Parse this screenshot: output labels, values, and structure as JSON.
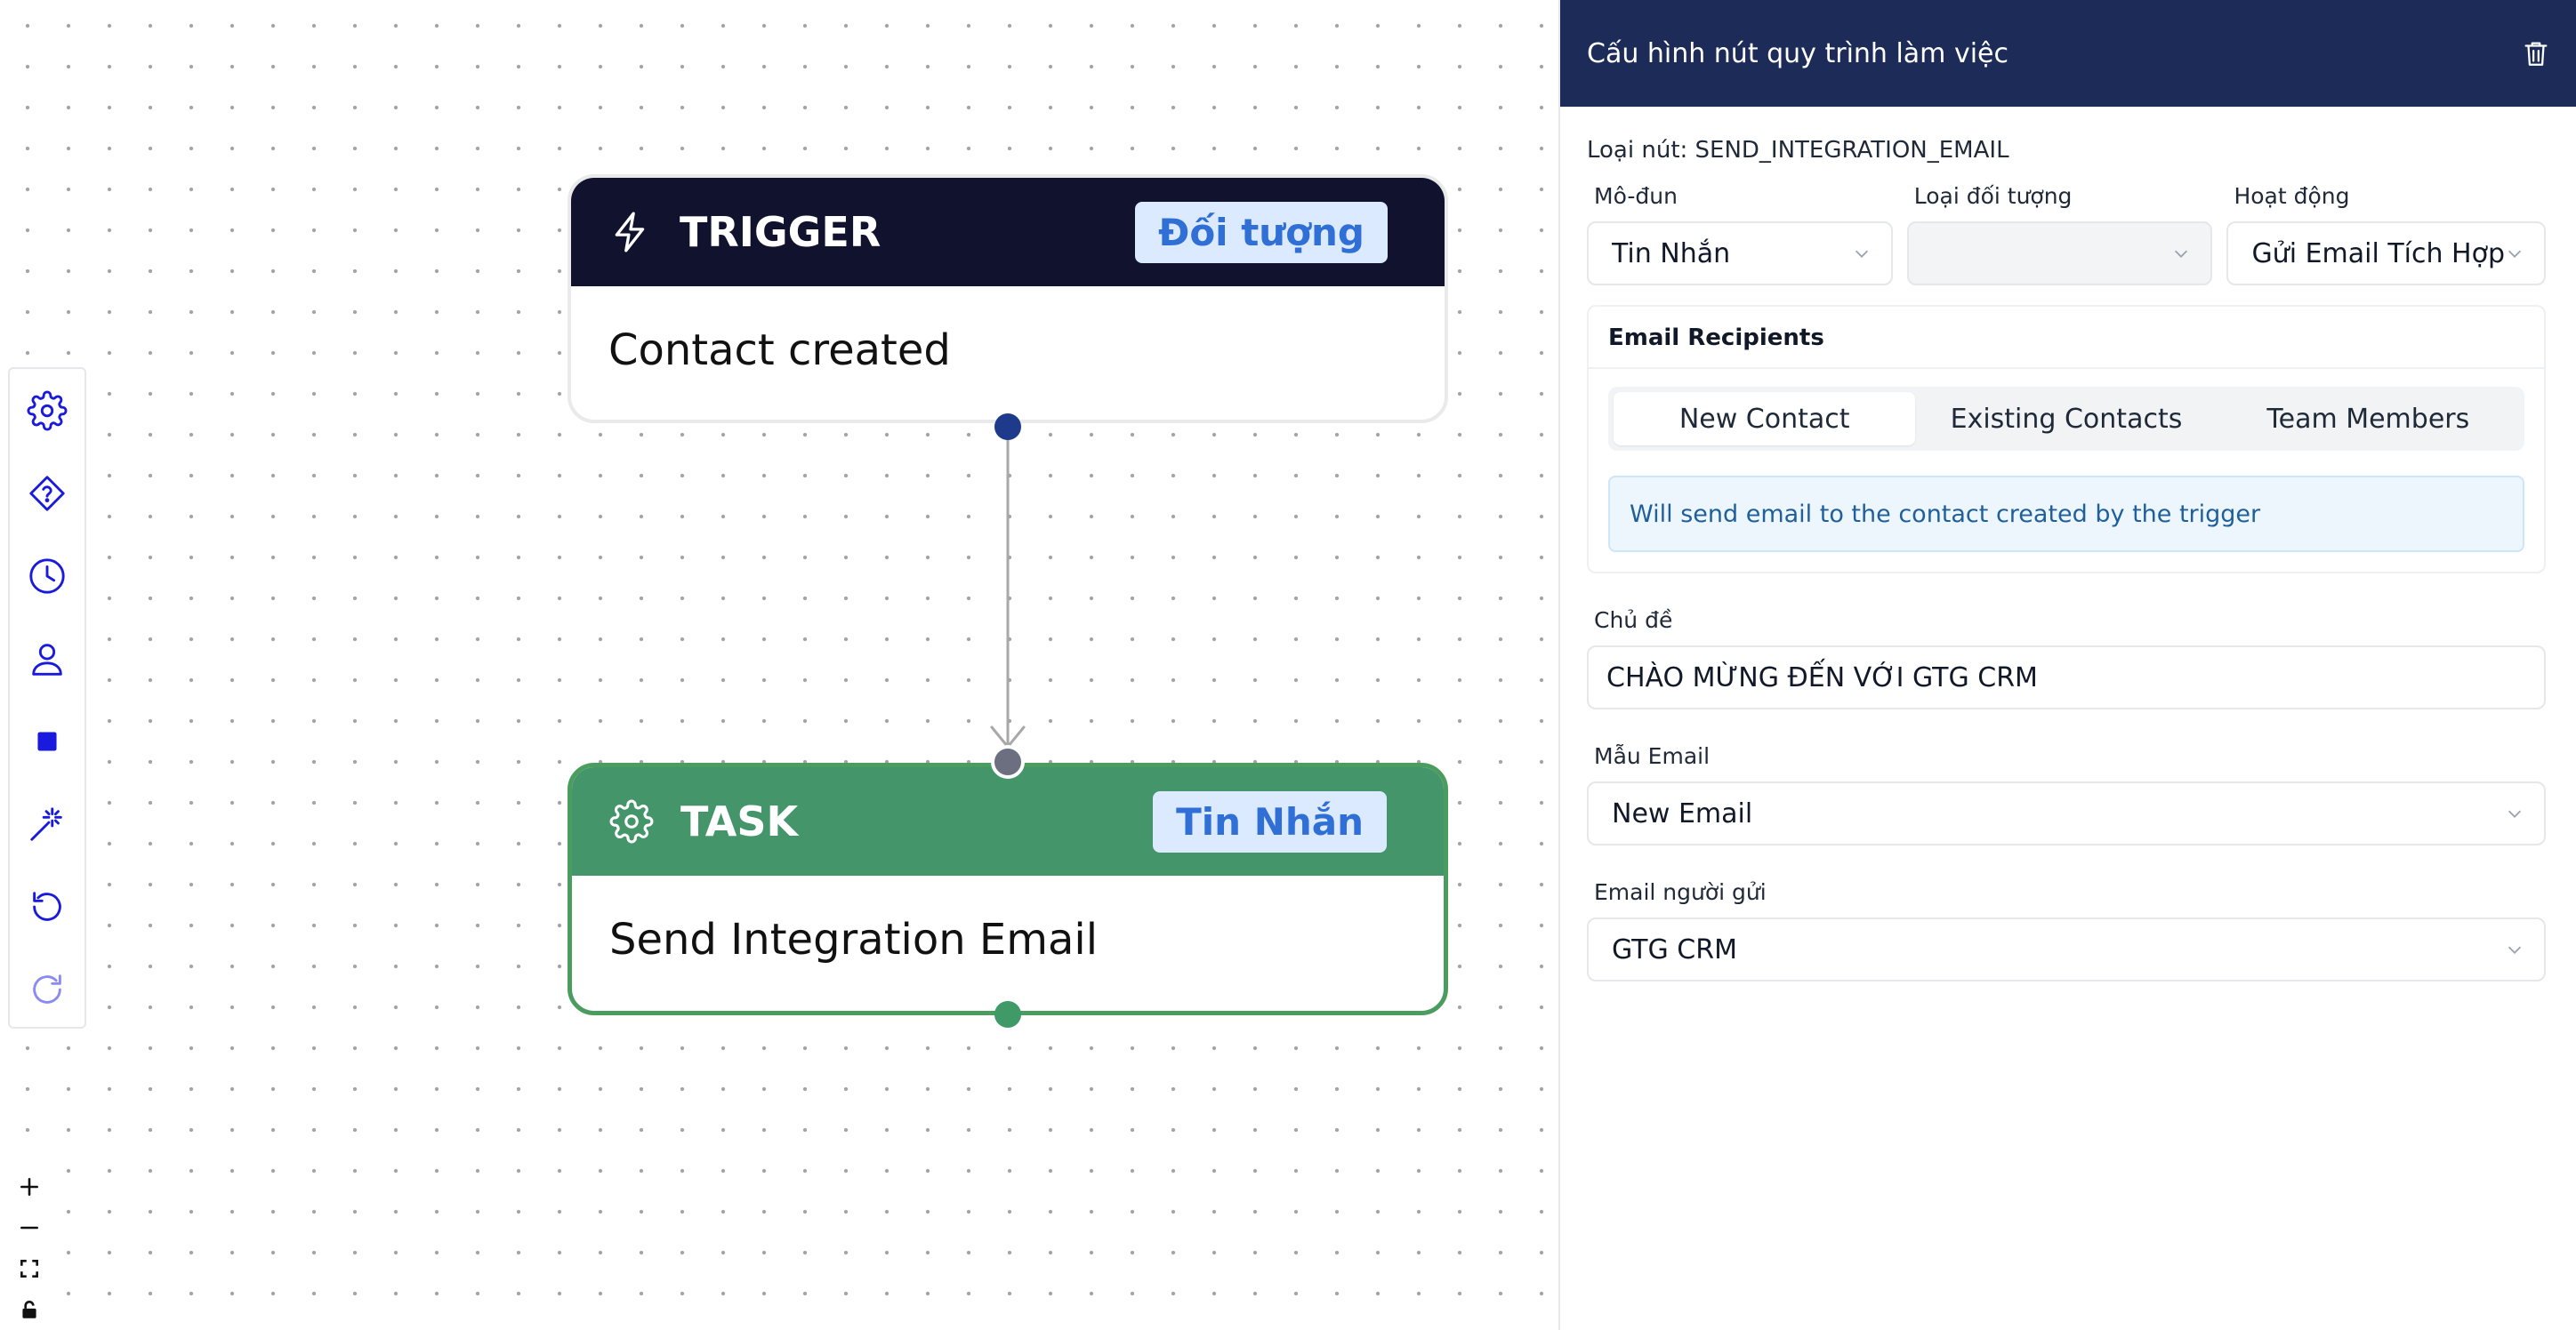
{
  "canvas": {
    "toolbar": [
      {
        "name": "settings-tool",
        "icon": "gear-icon"
      },
      {
        "name": "condition-tool",
        "icon": "diamond-question-icon"
      },
      {
        "name": "delay-tool",
        "icon": "clock-icon"
      },
      {
        "name": "contact-tool",
        "icon": "user-icon"
      },
      {
        "name": "stop-tool",
        "icon": "square-icon"
      },
      {
        "name": "magic-tool",
        "icon": "magic-wand-icon"
      },
      {
        "name": "undo-tool",
        "icon": "undo-icon"
      },
      {
        "name": "redo-tool",
        "icon": "redo-icon"
      }
    ],
    "zoom_controls": [
      "zoom-in-icon",
      "zoom-out-icon",
      "fit-view-icon",
      "lock-icon"
    ],
    "nodes": {
      "trigger": {
        "title": "TRIGGER",
        "badge": "Đối tượng",
        "body": "Contact created",
        "color": "#10122e"
      },
      "task": {
        "title": "TASK",
        "badge": "Tin Nhắn",
        "body": "Send Integration Email",
        "color": "#44956a"
      }
    },
    "accent": "#1a1adf"
  },
  "panel": {
    "title": "Cấu hình nút quy trình làm việc",
    "node_type_label": "Loại nút: SEND_INTEGRATION_EMAIL",
    "module": {
      "label": "Mô-đun",
      "value": "Tin Nhắn"
    },
    "object_type": {
      "label": "Loại đối tượng",
      "value": ""
    },
    "action": {
      "label": "Hoạt động",
      "value": "Gửi Email Tích Hợp"
    },
    "recipients": {
      "title": "Email Recipients",
      "tabs": [
        "New Contact",
        "Existing Contacts",
        "Team Members"
      ],
      "active_tab": "New Contact",
      "info": "Will send email to the contact created by the trigger"
    },
    "subject": {
      "label": "Chủ đề",
      "value": "CHÀO MỪNG ĐẾN VỚI GTG CRM"
    },
    "template": {
      "label": "Mẫu Email",
      "value": "New Email"
    },
    "sender": {
      "label": "Email người gửi",
      "value": "GTG CRM"
    },
    "header_color": "#1c2b57"
  }
}
